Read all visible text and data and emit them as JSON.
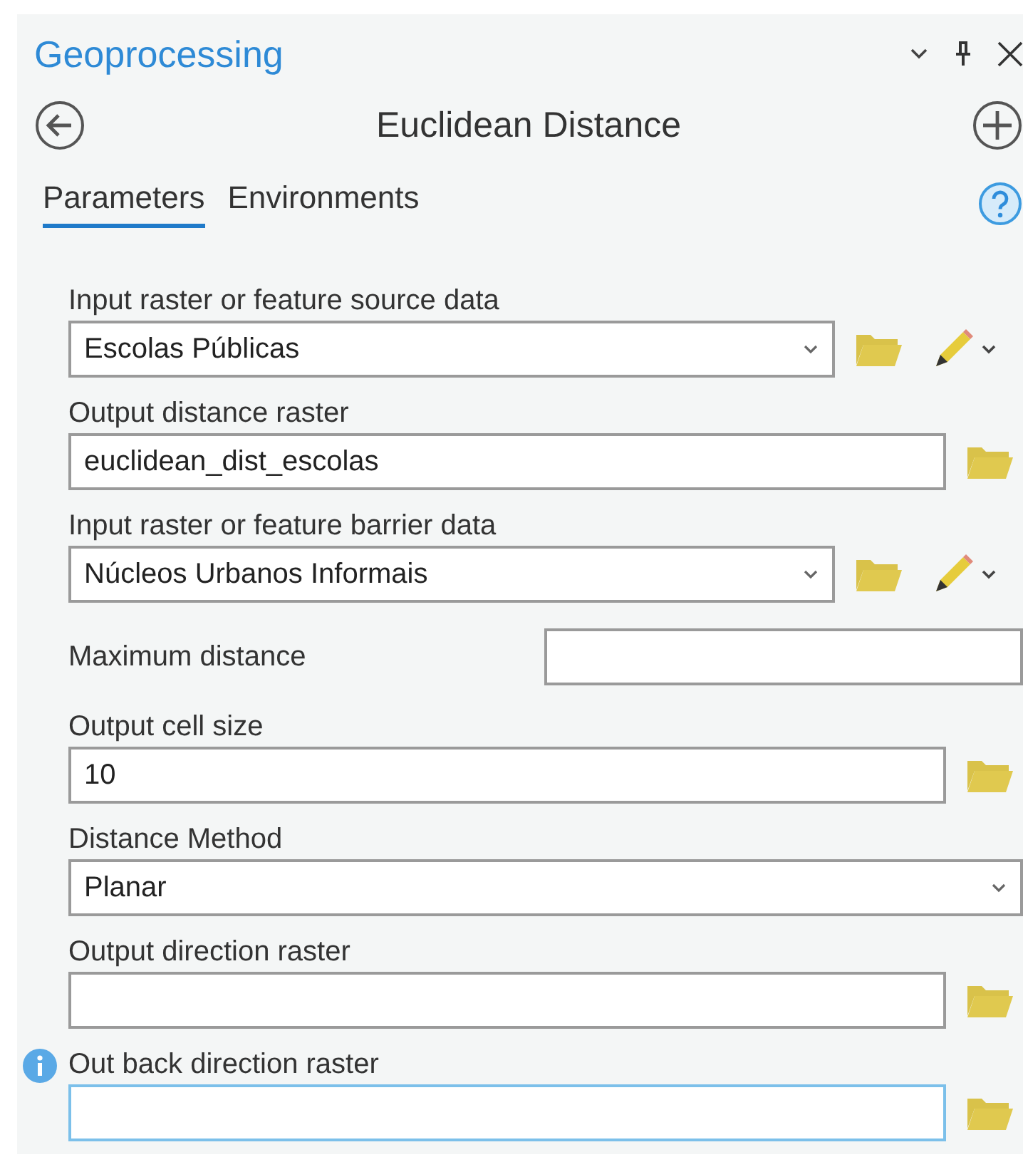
{
  "pane": {
    "title": "Geoprocessing"
  },
  "tool": {
    "title": "Euclidean Distance"
  },
  "tabs": [
    {
      "label": "Parameters",
      "selected": true
    },
    {
      "label": "Environments",
      "selected": false
    }
  ],
  "parameters": [
    {
      "kind": "dropdown",
      "label": "Input raster or feature source data",
      "value": "Escolas Públicas",
      "focused": false,
      "info": false
    },
    {
      "kind": "output",
      "label": "Output distance raster",
      "value": "euclidean_dist_escolas",
      "focused": false,
      "info": false
    },
    {
      "kind": "dropdown",
      "label": "Input raster or feature barrier data",
      "value": "Núcleos Urbanos Informais",
      "focused": false,
      "info": false
    },
    {
      "kind": "inline",
      "label": "Maximum distance",
      "focused": false,
      "info": false
    },
    {
      "kind": "output",
      "label": "Output cell size",
      "value": "10",
      "focused": false,
      "info": false
    },
    {
      "kind": "select",
      "label": "Distance Method",
      "value": "Planar",
      "focused": false,
      "info": false
    },
    {
      "kind": "output",
      "label": "Output direction raster",
      "focused": false,
      "info": false
    },
    {
      "kind": "output",
      "label": "Out back direction raster",
      "focused": true,
      "info": true
    }
  ]
}
